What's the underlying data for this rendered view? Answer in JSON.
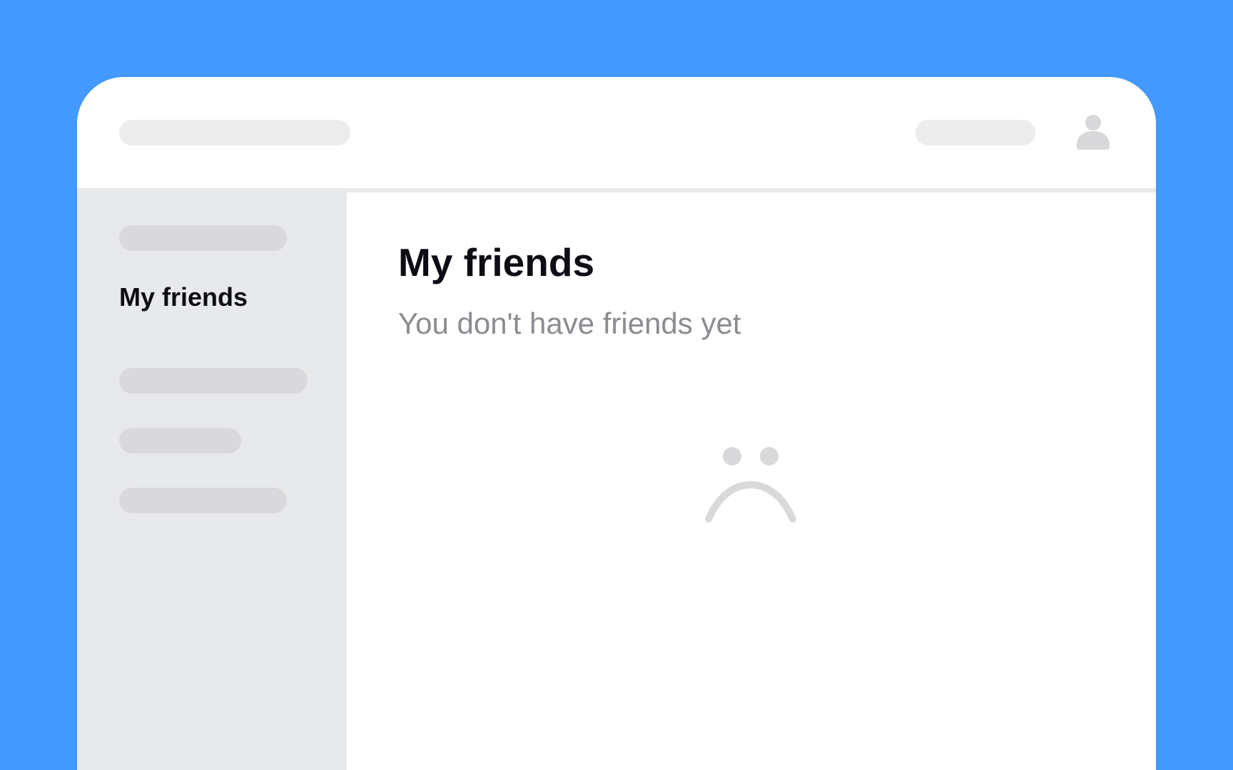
{
  "window": {
    "background": "#4399fd"
  },
  "header": {
    "search_placeholder_bar": "",
    "action_placeholder_bar": "",
    "avatar_icon": "user-icon"
  },
  "sidebar": {
    "active_item_label": "My friends"
  },
  "main": {
    "title": "My friends",
    "empty_message": "You don't have friends yet",
    "empty_icon": "sad-face-icon"
  },
  "colors": {
    "accent_background": "#4399fd",
    "skeleton": "#d9d9db",
    "sidebar_bg": "#e8e9eb",
    "text_primary": "#0d0e14",
    "text_muted": "#8b8b91"
  }
}
